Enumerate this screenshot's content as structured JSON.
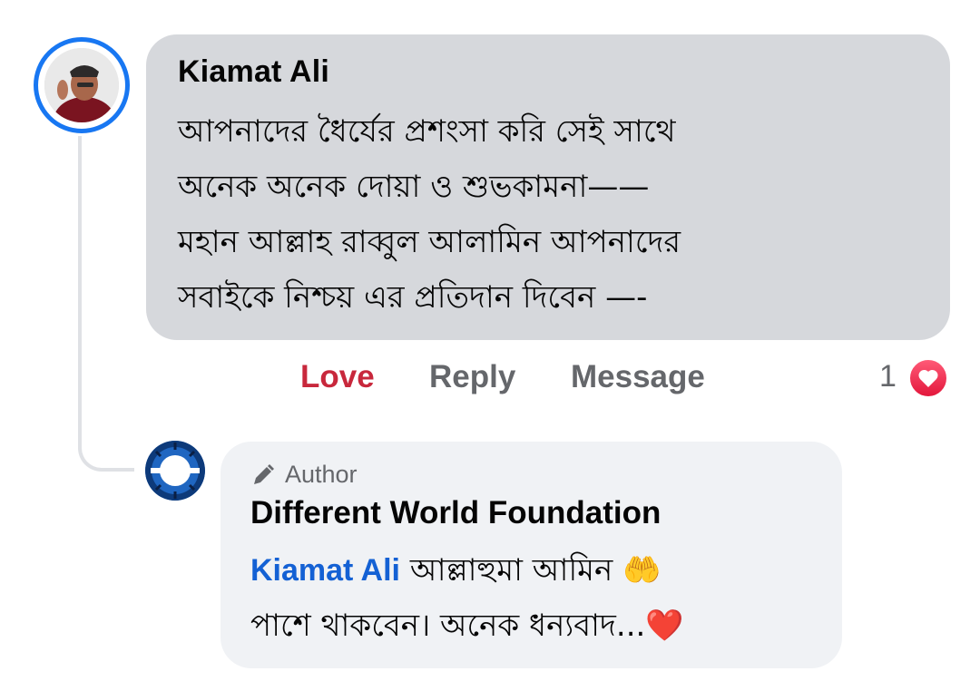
{
  "comment": {
    "author": "Kiamat Ali",
    "lines": [
      "আপনাদের ধৈর্যের প্রশংসা করি সেই সাথে",
      "অনেক অনেক দোয়া ও শুভকামনা——",
      "মহান আল্লাহ রাব্বুল আলামিন আপনাদের",
      "সবাইকে নিশ্চয় এর প্রতিদান দিবেন —-"
    ],
    "actions": {
      "love": "Love",
      "reply": "Reply",
      "message": "Message"
    },
    "reaction_count": "1",
    "reaction_icon": "heart-icon",
    "love_color": "#c8283c"
  },
  "reply": {
    "badge": "Author",
    "badge_icon": "pencil-icon",
    "author": "Different World Foundation",
    "mention": "Kiamat Ali",
    "line1_text": " আল্লাহুমা আমিন 🤲",
    "line2_text": "পাশে থাকবেন। অনেক ধন্যবাদ...❤️",
    "mention_color": "#1461d4"
  },
  "colors": {
    "accent": "#1877f2",
    "bubble_main": "#d6d8dc",
    "bubble_reply": "#f0f2f5"
  }
}
